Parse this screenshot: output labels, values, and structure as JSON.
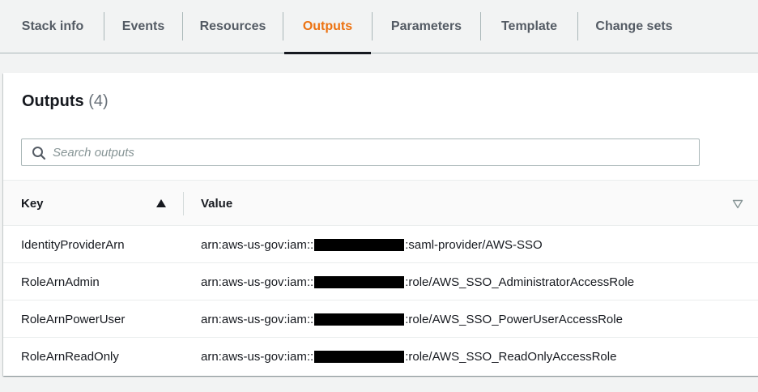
{
  "tabs": [
    {
      "label": "Stack info",
      "active": false
    },
    {
      "label": "Events",
      "active": false
    },
    {
      "label": "Resources",
      "active": false
    },
    {
      "label": "Outputs",
      "active": true
    },
    {
      "label": "Parameters",
      "active": false
    },
    {
      "label": "Template",
      "active": false
    },
    {
      "label": "Change sets",
      "active": false
    }
  ],
  "colors": {
    "accent": "#ec7211",
    "tab_text": "#545b64",
    "text": "#16191f"
  },
  "panel": {
    "title": "Outputs",
    "count": "(4)",
    "search": {
      "placeholder": "Search outputs",
      "value": "",
      "icon": "search-icon"
    }
  },
  "table": {
    "columns": [
      {
        "label": "Key",
        "sort": "ascending",
        "icon": "sort-up-icon"
      },
      {
        "label": "Value",
        "icon": "sort-down-icon"
      }
    ],
    "rows": [
      {
        "key": "IdentityProviderArn",
        "value_prefix": "arn:aws-us-gov:iam::",
        "value_suffix": ":saml-provider/AWS-SSO"
      },
      {
        "key": "RoleArnAdmin",
        "value_prefix": "arn:aws-us-gov:iam::",
        "value_suffix": ":role/AWS_SSO_AdministratorAccessRole"
      },
      {
        "key": "RoleArnPowerUser",
        "value_prefix": "arn:aws-us-gov:iam::",
        "value_suffix": ":role/AWS_SSO_PowerUserAccessRole"
      },
      {
        "key": "RoleArnReadOnly",
        "value_prefix": "arn:aws-us-gov:iam::",
        "value_suffix": ":role/AWS_SSO_ReadOnlyAccessRole"
      }
    ]
  }
}
